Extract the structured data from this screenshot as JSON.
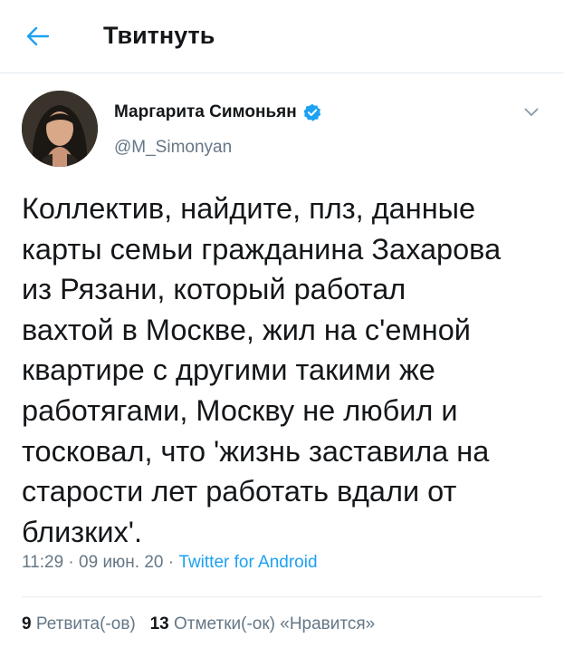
{
  "header": {
    "title": "Твитнуть",
    "back_icon": "arrow-left-icon",
    "accent_color": "#1da1f2"
  },
  "author": {
    "name": "Маргарита Симоньян",
    "handle": "@M_Simonyan",
    "verified": true,
    "verified_color": "#1da1f2"
  },
  "tweet": {
    "text": "Коллектив, найдите, плз, данные\nкарты семьи гражданина Захарова\nиз Рязани, который работал\nвахтой в Москве, жил на с'емной\nквартире с другими такими же\nработягами, Москву не любил и\nтосковал, что 'жизнь заставила на\nстарости лет работать вдали от\nблизких'."
  },
  "meta": {
    "time": "11:29",
    "separator": " · ",
    "date": "09 июн. 20",
    "source": "Twitter for Android"
  },
  "stats": {
    "retweets_count": "9",
    "retweets_label": "Ретвита(-ов)",
    "likes_count": "13",
    "likes_label": "Отметки(-ок) «Нравится»"
  }
}
